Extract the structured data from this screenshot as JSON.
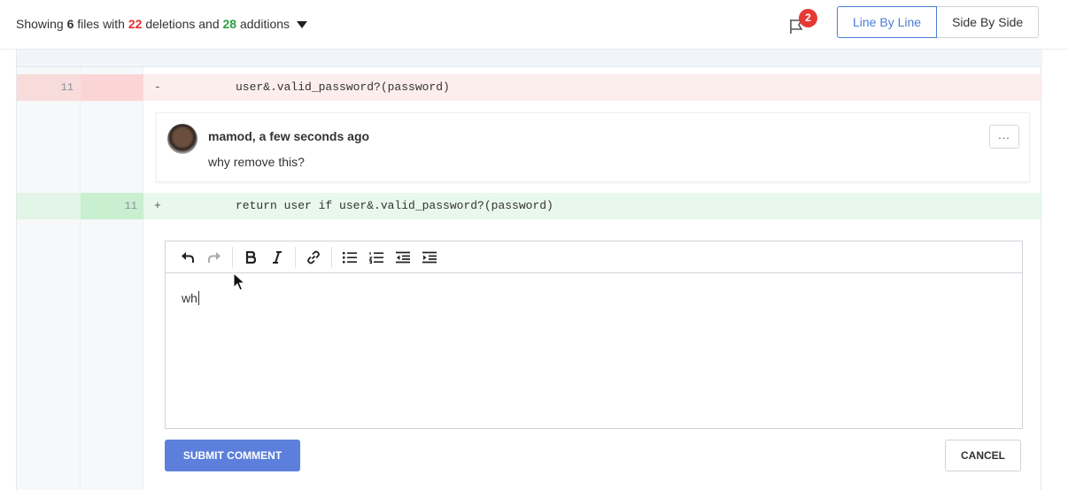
{
  "summary": {
    "prefix": "Showing ",
    "files_count": "6",
    "files_mid": " files with ",
    "deletions": "22",
    "deletions_mid": " deletions and ",
    "additions": "28",
    "additions_suffix": " additions"
  },
  "notifications": {
    "count": "2"
  },
  "view_switch": {
    "line_by_line": "Line By Line",
    "side_by_side": "Side By Side"
  },
  "diff": {
    "deleted_line": {
      "old_number": "11",
      "sign": "-",
      "code": "user&.valid_password?(password)"
    },
    "added_line": {
      "new_number": "11",
      "sign": "+",
      "code": "return user if user&.valid_password?(password)"
    }
  },
  "comment": {
    "author_line": "mamod, a few seconds ago",
    "body": "why remove this?",
    "menu_label": "..."
  },
  "editor": {
    "text": "wh",
    "toolbar": [
      "undo-icon",
      "redo-icon",
      "bold-icon",
      "italic-icon",
      "link-icon",
      "bullet-list-icon",
      "numbered-list-icon",
      "outdent-icon",
      "indent-icon"
    ]
  },
  "actions": {
    "submit": "SUBMIT COMMENT",
    "cancel": "CANCEL"
  },
  "colors": {
    "accent": "#4a7dd8",
    "deletions": "#e03131",
    "additions": "#2f9e44",
    "submit": "#5b7fdb",
    "badge": "#e53935"
  }
}
